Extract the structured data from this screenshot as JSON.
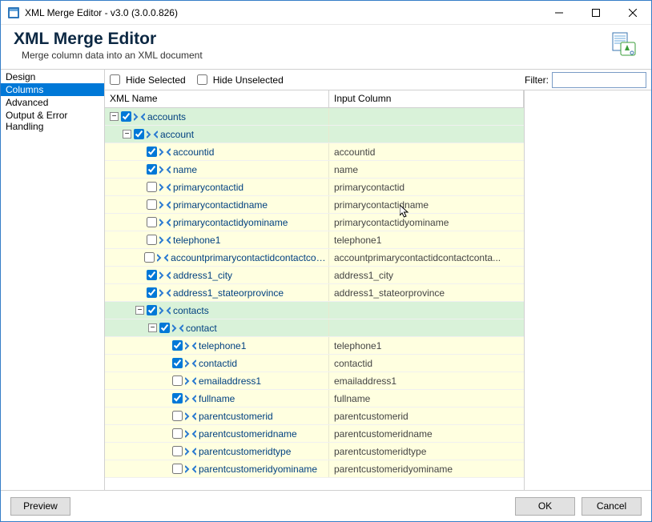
{
  "window": {
    "title": "XML Merge Editor - v3.0 (3.0.0.826)"
  },
  "header": {
    "title": "XML Merge Editor",
    "subtitle": "Merge column data into an XML document"
  },
  "sidebar": {
    "items": [
      {
        "label": "Design",
        "selected": false
      },
      {
        "label": "Columns",
        "selected": true
      },
      {
        "label": "Advanced",
        "selected": false
      },
      {
        "label": "Output & Error Handling",
        "selected": false
      }
    ]
  },
  "toolbar": {
    "hideSelected": "Hide Selected",
    "hideUnselected": "Hide Unselected",
    "filterLabel": "Filter:",
    "filterValue": ""
  },
  "grid": {
    "headers": {
      "name": "XML Name",
      "input": "Input Column"
    },
    "rows": [
      {
        "depth": 0,
        "expander": true,
        "checked": true,
        "group": true,
        "name": "accounts",
        "input": ""
      },
      {
        "depth": 1,
        "expander": true,
        "checked": true,
        "group": true,
        "name": "account",
        "input": ""
      },
      {
        "depth": 2,
        "expander": false,
        "checked": true,
        "group": false,
        "name": "accountid",
        "input": "accountid"
      },
      {
        "depth": 2,
        "expander": false,
        "checked": true,
        "group": false,
        "name": "name",
        "input": "name"
      },
      {
        "depth": 2,
        "expander": false,
        "checked": false,
        "group": false,
        "name": "primarycontactid",
        "input": "primarycontactid"
      },
      {
        "depth": 2,
        "expander": false,
        "checked": false,
        "group": false,
        "name": "primarycontactidname",
        "input": "primarycontactidname"
      },
      {
        "depth": 2,
        "expander": false,
        "checked": false,
        "group": false,
        "name": "primarycontactidyominame",
        "input": "primarycontactidyominame"
      },
      {
        "depth": 2,
        "expander": false,
        "checked": false,
        "group": false,
        "name": "telephone1",
        "input": "telephone1"
      },
      {
        "depth": 2,
        "expander": false,
        "checked": false,
        "group": false,
        "name": "accountprimarycontactidcontactconta...",
        "input": "accountprimarycontactidcontactconta..."
      },
      {
        "depth": 2,
        "expander": false,
        "checked": true,
        "group": false,
        "name": "address1_city",
        "input": "address1_city"
      },
      {
        "depth": 2,
        "expander": false,
        "checked": true,
        "group": false,
        "name": "address1_stateorprovince",
        "input": "address1_stateorprovince"
      },
      {
        "depth": 2,
        "expander": true,
        "checked": true,
        "group": true,
        "name": "contacts",
        "input": ""
      },
      {
        "depth": 3,
        "expander": true,
        "checked": true,
        "group": true,
        "name": "contact",
        "input": ""
      },
      {
        "depth": 4,
        "expander": false,
        "checked": true,
        "group": false,
        "name": "telephone1",
        "input": "telephone1"
      },
      {
        "depth": 4,
        "expander": false,
        "checked": true,
        "group": false,
        "name": "contactid",
        "input": "contactid"
      },
      {
        "depth": 4,
        "expander": false,
        "checked": false,
        "group": false,
        "name": "emailaddress1",
        "input": "emailaddress1"
      },
      {
        "depth": 4,
        "expander": false,
        "checked": true,
        "group": false,
        "name": "fullname",
        "input": "fullname"
      },
      {
        "depth": 4,
        "expander": false,
        "checked": false,
        "group": false,
        "name": "parentcustomerid",
        "input": "parentcustomerid"
      },
      {
        "depth": 4,
        "expander": false,
        "checked": false,
        "group": false,
        "name": "parentcustomeridname",
        "input": "parentcustomeridname"
      },
      {
        "depth": 4,
        "expander": false,
        "checked": false,
        "group": false,
        "name": "parentcustomeridtype",
        "input": "parentcustomeridtype"
      },
      {
        "depth": 4,
        "expander": false,
        "checked": false,
        "group": false,
        "name": "parentcustomeridyominame",
        "input": "parentcustomeridyominame"
      }
    ]
  },
  "footer": {
    "preview": "Preview",
    "ok": "OK",
    "cancel": "Cancel"
  }
}
